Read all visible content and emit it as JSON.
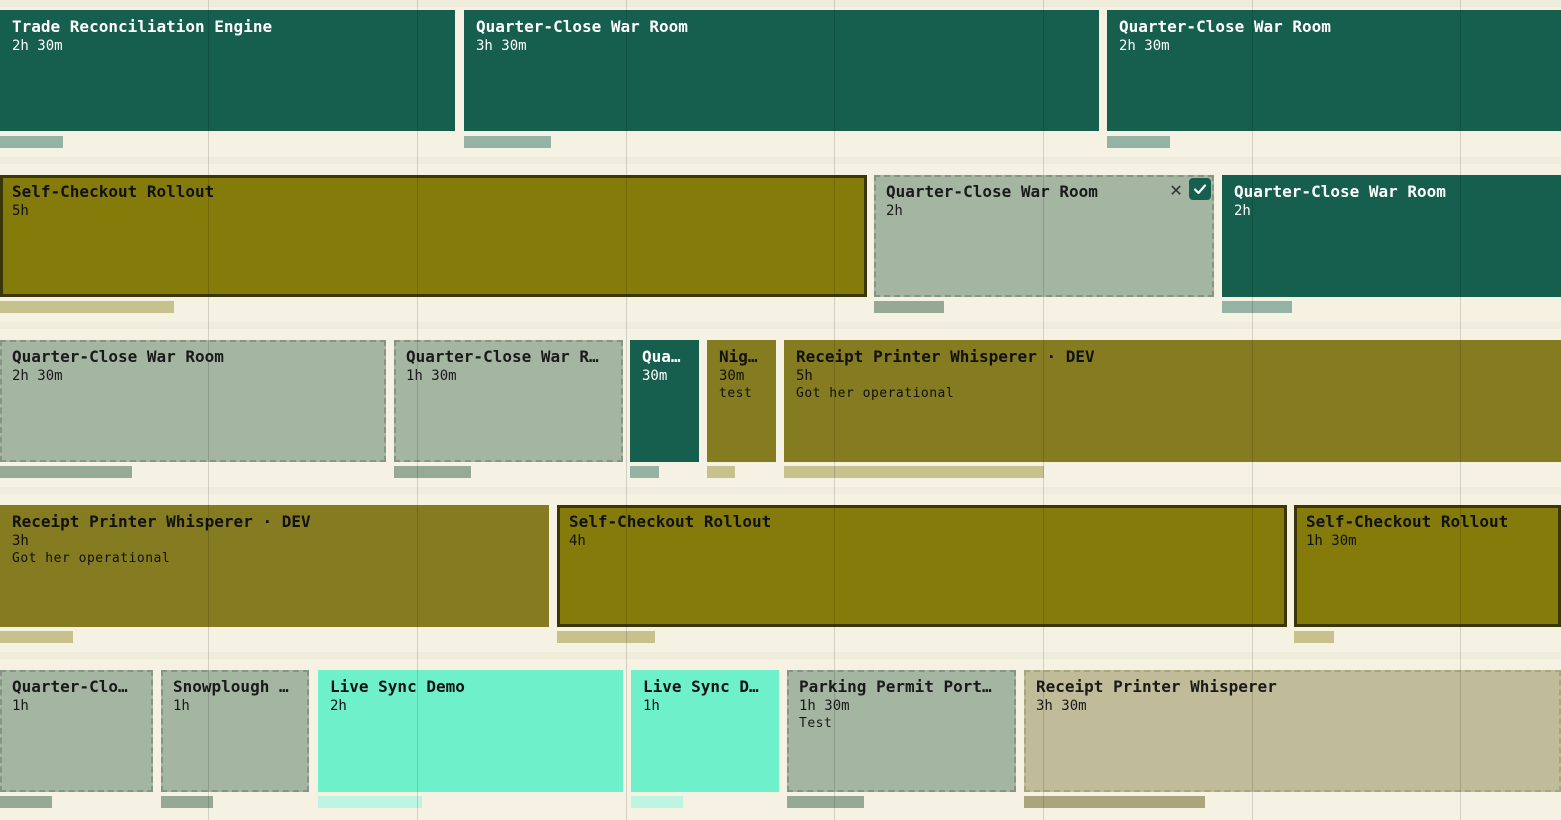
{
  "rows": [
    {
      "events": [
        {
          "title": "Trade Reconciliation Engine",
          "duration": "2h 30m"
        },
        {
          "title": "Quarter-Close War Room",
          "duration": "3h 30m"
        },
        {
          "title": "Quarter-Close War Room",
          "duration": "2h 30m"
        }
      ]
    },
    {
      "events": [
        {
          "title": "Self-Checkout Rollout",
          "duration": "5h"
        },
        {
          "title": "Quarter-Close War Room",
          "duration": "2h"
        },
        {
          "title": "Quarter-Close War Room",
          "duration": "2h"
        }
      ]
    },
    {
      "events": [
        {
          "title": "Quarter-Close War Room",
          "duration": "2h 30m"
        },
        {
          "title": "Quarter-Close War R…",
          "duration": "1h 30m"
        },
        {
          "title": "Qua…",
          "duration": "30m"
        },
        {
          "title": "Nig…",
          "duration": "30m",
          "note": "test"
        },
        {
          "title": "Receipt Printer Whisperer · DEV",
          "duration": "5h",
          "note": "Got her operational"
        }
      ]
    },
    {
      "events": [
        {
          "title": "Receipt Printer Whisperer · DEV",
          "duration": "3h",
          "note": "Got her operational"
        },
        {
          "title": "Self-Checkout Rollout",
          "duration": "4h"
        },
        {
          "title": "Self-Checkout Rollout",
          "duration": "1h 30m"
        }
      ]
    },
    {
      "events": [
        {
          "title": "Quarter-Clo…",
          "duration": "1h"
        },
        {
          "title": "Snowplough …",
          "duration": "1h"
        },
        {
          "title": "Live Sync Demo",
          "duration": "2h"
        },
        {
          "title": "Live Sync D…",
          "duration": "1h"
        },
        {
          "title": "Parking Permit Port…",
          "duration": "1h 30m",
          "note": "Test"
        },
        {
          "title": "Receipt Printer Whisperer",
          "duration": "3h 30m"
        }
      ]
    }
  ],
  "controls": {
    "close_glyph": "✕"
  },
  "colors": {
    "dark_green": "#165e4d",
    "olive": "#847b0a",
    "olive_light": "#857b20",
    "ghost": "#a4b5a2",
    "mint": "#6ef0cb",
    "tan": "#c0bc99",
    "background": "#f6f2e3"
  }
}
